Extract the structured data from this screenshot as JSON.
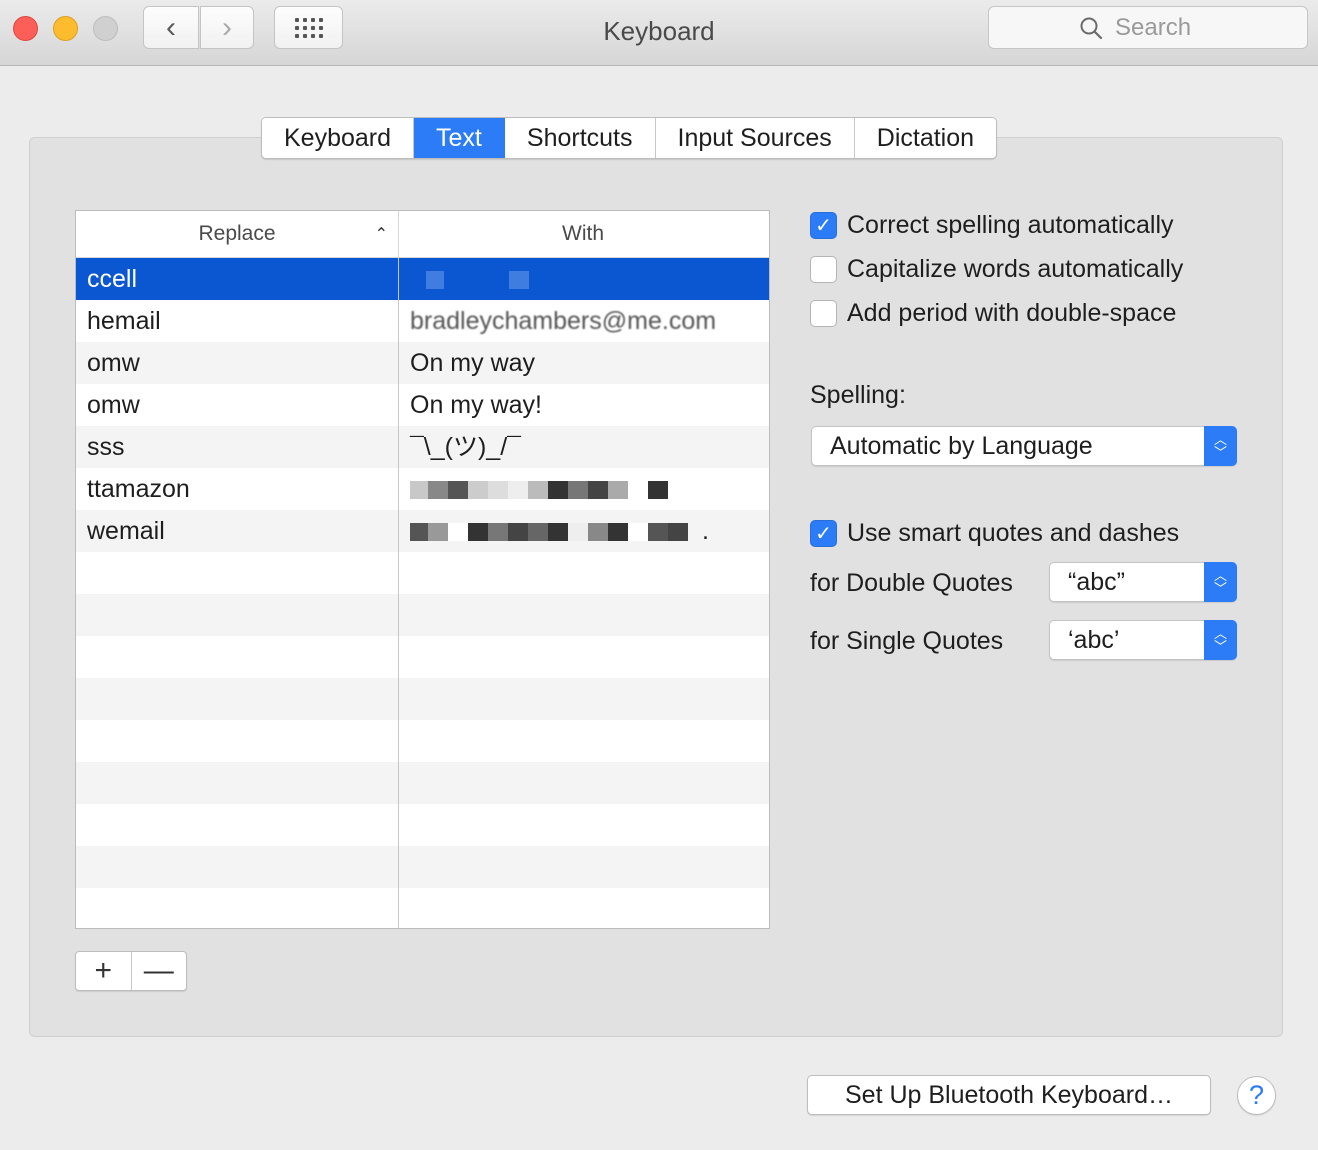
{
  "window": {
    "title": "Keyboard"
  },
  "toolbar": {
    "search_placeholder": "Search"
  },
  "tabs": [
    {
      "label": "Keyboard",
      "active": false
    },
    {
      "label": "Text",
      "active": true
    },
    {
      "label": "Shortcuts",
      "active": false
    },
    {
      "label": "Input Sources",
      "active": false
    },
    {
      "label": "Dictation",
      "active": false
    }
  ],
  "table": {
    "columns": [
      "Replace",
      "With"
    ],
    "rows": [
      {
        "replace": "ccell",
        "with": "",
        "selected": true
      },
      {
        "replace": "hemail",
        "with": "bradleychambers@me.com",
        "selected": false
      },
      {
        "replace": "omw",
        "with": "On my way",
        "selected": false
      },
      {
        "replace": "omw",
        "with": "On my way!",
        "selected": false
      },
      {
        "replace": "sss",
        "with": "¯\\_(ツ)_/¯",
        "selected": false
      },
      {
        "replace": "ttamazon",
        "with": "",
        "selected": false
      },
      {
        "replace": "wemail",
        "with": ".",
        "selected": false
      }
    ]
  },
  "buttons": {
    "add": "+",
    "remove": "—",
    "bluetooth": "Set Up Bluetooth Keyboard…",
    "help": "?"
  },
  "options": {
    "correct_spelling": {
      "label": "Correct spelling automatically",
      "checked": true
    },
    "capitalize": {
      "label": "Capitalize words automatically",
      "checked": false
    },
    "add_period": {
      "label": "Add period with double-space",
      "checked": false
    },
    "spelling_label": "Spelling:",
    "spelling_value": "Automatic by Language",
    "smart_quotes": {
      "label": "Use smart quotes and dashes",
      "checked": true
    },
    "double_quotes_label": "for Double Quotes",
    "double_quotes_value": "“abc”",
    "single_quotes_label": "for Single Quotes",
    "single_quotes_value": "‘abc’"
  },
  "colors": {
    "accent": "#2b7cf6",
    "selection": "#0b56d1"
  }
}
